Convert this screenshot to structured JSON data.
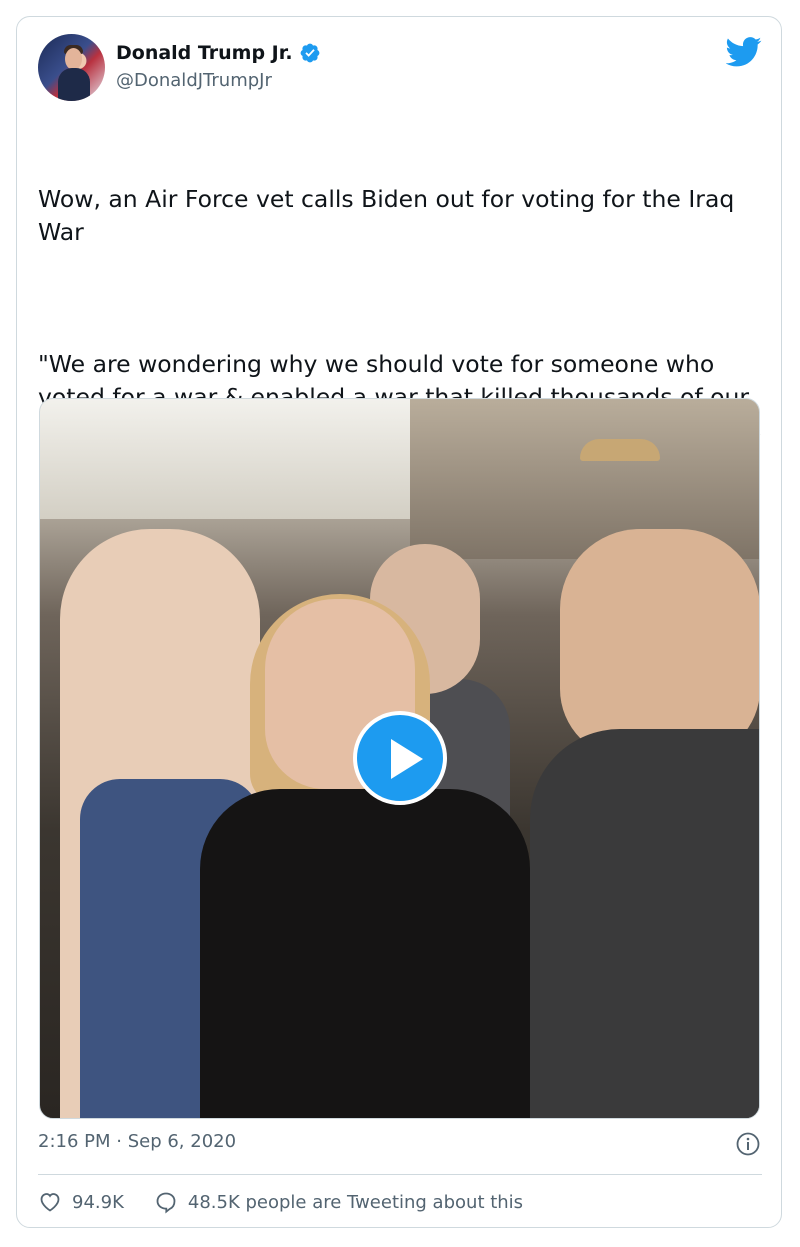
{
  "tweet": {
    "author": {
      "display_name": "Donald Trump Jr.",
      "handle": "@DonaldJTrumpJr",
      "verified": true
    },
    "text_paragraphs": [
      "Wow, an Air Force vet calls Biden out for voting for the Iraq War",
      "\"We are wondering why we should vote for someone who voted for a war & enabled a war that killed thousands of our brothers & sisters?...Their blood is on your hands...My friends are dead because of your policies!\""
    ],
    "timestamp": "2:16 PM · Sep 6, 2020",
    "likes": "94.9K",
    "tweeting_about": "48.5K people are Tweeting about this"
  },
  "icons": {
    "brand": "twitter-bird-icon",
    "verified": "verified-badge-icon",
    "play": "play-icon",
    "info": "info-icon",
    "like": "heart-icon",
    "reply": "speech-bubble-icon"
  },
  "colors": {
    "accent": "#1d9bf0",
    "text": "#0f1419",
    "secondary": "#536471",
    "border": "#cfd9de"
  }
}
